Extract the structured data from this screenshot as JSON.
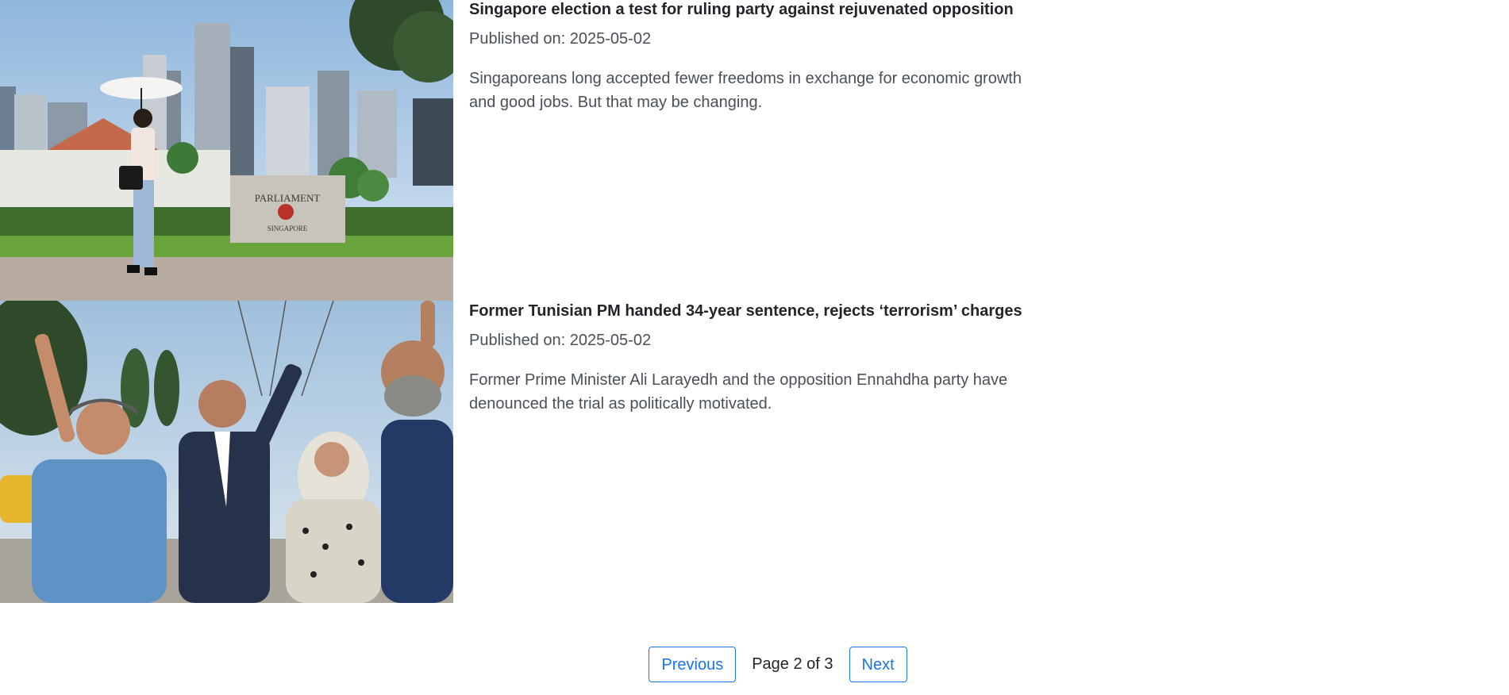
{
  "articles": [
    {
      "title": "Singapore election a test for ruling party against rejuvenated opposition",
      "published": "Published on: 2025-05-02",
      "summary": "Singaporeans long accepted fewer freedoms in exchange for economic growth and good jobs. But that may be changing.",
      "image_sign_top": "PARLIAMENT",
      "image_sign_bottom": "SINGAPORE"
    },
    {
      "title": "Former Tunisian PM handed 34-year sentence, rejects ‘terrorism’ charges",
      "published": "Published on: 2025-05-02",
      "summary": "Former Prime Minister Ali Larayedh and the opposition Ennahdha party have denounced the trial as politically motivated."
    }
  ],
  "pagination": {
    "previous_label": "Previous",
    "page_info": "Page 2 of 3",
    "next_label": "Next"
  },
  "colors": {
    "link": "#1a73e8",
    "text": "#212529",
    "muted": "#495057"
  }
}
